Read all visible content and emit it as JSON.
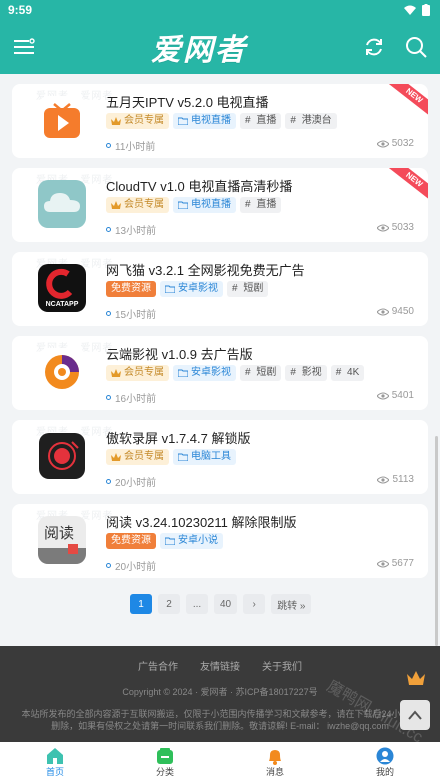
{
  "status": {
    "time": "9:59"
  },
  "header": {
    "logo": "爱网者",
    "menu_icon": "menu-icon",
    "refresh_icon": "refresh-icon",
    "search_icon": "search-icon"
  },
  "watermark": "爱网者",
  "items": [
    {
      "title": "五月天IPTV v5.2.0 电视直播",
      "access": "会员专属",
      "category": "电视直播",
      "keywords": [
        "直播",
        "港澳台"
      ],
      "time": "11小时前",
      "views": "5032",
      "badge": "NEW"
    },
    {
      "title": "CloudTV v1.0 电视直播高清秒播",
      "access": "会员专属",
      "category": "电视直播",
      "keywords": [
        "直播"
      ],
      "time": "13小时前",
      "views": "5033",
      "badge": "NEW"
    },
    {
      "title": "网飞猫 v3.2.1 全网影视免费无广告",
      "access": "免费资源",
      "category": "安卓影视",
      "keywords": [
        "短剧"
      ],
      "time": "15小时前",
      "views": "9450",
      "thumb_text": "NCATAPP"
    },
    {
      "title": "云端影视 v1.0.9 去广告版",
      "access": "会员专属",
      "category": "安卓影视",
      "keywords": [
        "短剧",
        "影视",
        "4K"
      ],
      "time": "16小时前",
      "views": "5401"
    },
    {
      "title": "傲软录屏 v1.7.4.7 解锁版",
      "access": "会员专属",
      "category": "电脑工具",
      "keywords": [],
      "time": "20小时前",
      "views": "5113"
    },
    {
      "title": "阅读 v3.24.10230211 解除限制版",
      "access": "免费资源",
      "category": "安卓小说",
      "keywords": [],
      "time": "20小时前",
      "views": "5677",
      "thumb_text": "阅读"
    }
  ],
  "pagination": {
    "pages": [
      "1",
      "2",
      "...",
      "40"
    ],
    "current": "1",
    "next": "›",
    "jump": "跳转 »"
  },
  "footer": {
    "links": [
      "广告合作",
      "友情链接",
      "关于我们"
    ],
    "copyright": "Copyright © 2024 · 爱网者 · 苏ICP备18017227号",
    "notice": "本站所发布的全部内容源于互联网搬运，仅限于小范围内传播学习和文献参考，请在下载后24小时内删除，如果有侵权之处请第一时间联系我们删除。敬请谅解! E-mail：",
    "email": "iwzhe@qq.com",
    "watermark": "魔鸭网 mfuit.cc"
  },
  "nav": [
    {
      "label": "首页",
      "icon": "home-icon",
      "active": true
    },
    {
      "label": "分类",
      "icon": "category-icon",
      "active": false
    },
    {
      "label": "消息",
      "icon": "bell-icon",
      "active": false
    },
    {
      "label": "我的",
      "icon": "user-icon",
      "active": false
    }
  ],
  "colors": {
    "header": "#27b6a6",
    "accent": "#1e88e5",
    "badge": "#f44b5a",
    "free": "#f07f3a"
  }
}
